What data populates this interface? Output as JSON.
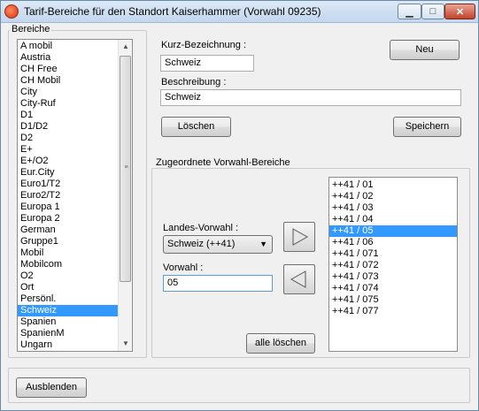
{
  "window": {
    "title": "Tarif-Bereiche für den Standort Kaiserhammer (Vorwahl 09235)",
    "minimize_glyph": "▁",
    "maximize_glyph": "□",
    "close_glyph": "✕"
  },
  "bereiche": {
    "label": "Bereiche",
    "items": [
      "A mobil",
      "Austria",
      "CH Free",
      "CH Mobil",
      "City",
      "City-Ruf",
      "D1",
      "D1/D2",
      "D2",
      "E+",
      "E+/O2",
      "Eur.City",
      "Euro1/T2",
      "Euro2/T2",
      "Europa 1",
      "Europa 2",
      "German",
      "Gruppe1",
      "Mobil",
      "Mobilcom",
      "O2",
      "Ort",
      "Persönl.",
      "Schweiz",
      "Spanien",
      "SpanienM",
      "Ungarn"
    ],
    "selected": "Schweiz",
    "scroll_up_glyph": "▲",
    "scroll_down_glyph": "▼",
    "scroll_grip_glyph": "≡"
  },
  "details": {
    "kurz_label": "Kurz-Bezeichnung :",
    "kurz_value": "Schweiz",
    "beschreibung_label": "Beschreibung :",
    "beschreibung_value": "Schweiz",
    "neu_button": "Neu",
    "loeschen_button": "Löschen",
    "speichern_button": "Speichern"
  },
  "vorwahl_bereiche": {
    "label": "Zugeordnete Vorwahl-Bereiche",
    "landes_label": "Landes-Vorwahl :",
    "landes_value": "Schweiz (++41)",
    "combo_arrow": "▼",
    "vorwahl_label": "Vorwahl :",
    "vorwahl_value": "05",
    "add_icon": "arrow-right-icon",
    "remove_icon": "arrow-left-icon",
    "alle_loeschen_button": "alle löschen",
    "items": [
      "++41 / 01",
      "++41 / 02",
      "++41 / 03",
      "++41 / 04",
      "++41 / 05",
      "++41 / 06",
      "++41 / 071",
      "++41 / 072",
      "++41 / 073",
      "++41 / 074",
      "++41 / 075",
      "++41 / 077"
    ],
    "selected": "++41 / 05"
  },
  "footer": {
    "ausblenden_button": "Ausblenden"
  },
  "colors": {
    "selection": "#3399ff",
    "window_bg": "#f0f0f0",
    "close_button": "#c1432b"
  }
}
